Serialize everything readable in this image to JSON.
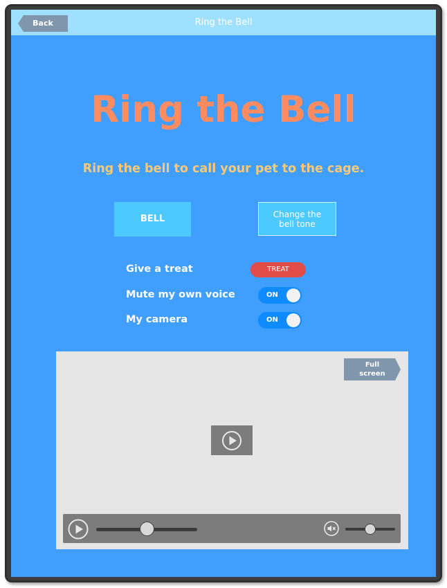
{
  "header": {
    "back_label": "Back",
    "title": "Ring the Bell"
  },
  "main": {
    "title": "Ring the Bell",
    "subtitle": "Ring the bell to call your pet to the cage.",
    "bell_button_label": "BELL",
    "tone_button_label": "Change the bell tone"
  },
  "settings": {
    "treat_label": "Give a treat",
    "treat_button_label": "TREAT",
    "mute_label": "Mute my own voice",
    "mute_state": "ON",
    "camera_label": "My camera",
    "camera_state": "ON"
  },
  "video": {
    "fullscreen_label": "Full screen",
    "seek_progress": 0.5,
    "volume_level": 0.5
  },
  "colors": {
    "background": "#409eff",
    "topbar": "#9fe0ff",
    "title": "#fe8c60",
    "subtitle": "#f7c972",
    "button": "#4cc9ff",
    "treat": "#e24c48",
    "toggle": "#0e8bff"
  },
  "icons": [
    "play-icon",
    "play-circle-icon",
    "mute-icon"
  ]
}
